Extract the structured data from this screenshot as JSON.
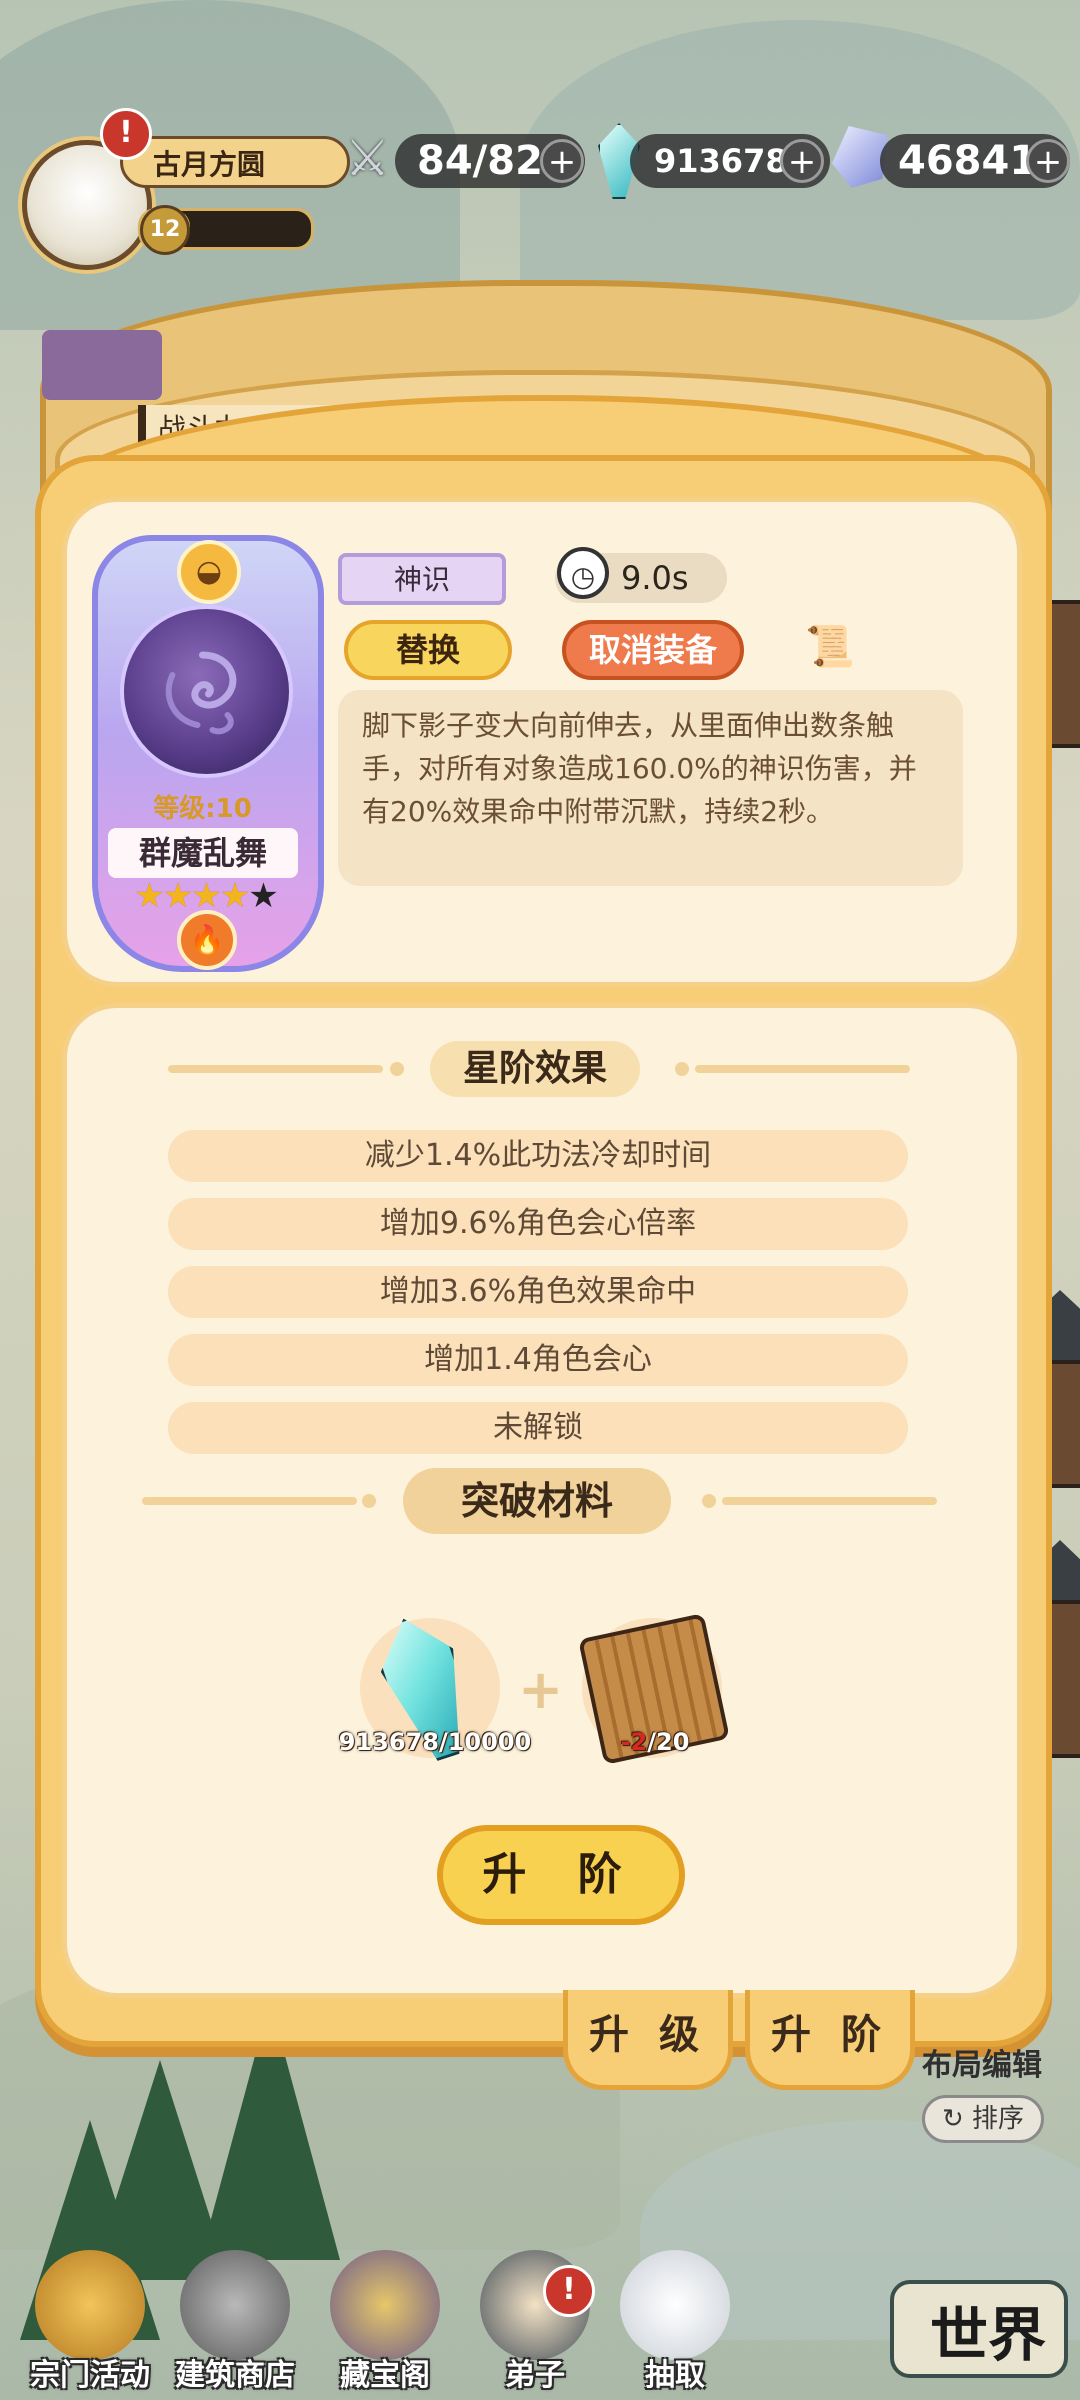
{
  "player": {
    "name": "古月方圆",
    "level": "12",
    "level_progress": 0.3,
    "alert": "!"
  },
  "resources": [
    {
      "icon": "sword-icon",
      "value": "84/82",
      "plus": "+"
    },
    {
      "icon": "crystal-icon",
      "value": "913678",
      "plus": "+"
    },
    {
      "icon": "gem-icon",
      "value": "46841",
      "plus": "+"
    }
  ],
  "background_panel": {
    "label": "战斗力"
  },
  "skill": {
    "level_text": "等级:10",
    "name": "群魔乱舞",
    "stars_filled": 4,
    "stars_total": 5,
    "star_glyph": "★",
    "type": "神识",
    "cooldown": "9.0s",
    "replace_label": "替换",
    "unequip_label": "取消装备",
    "description": "脚下影子变大向前伸去，从里面伸出数条触手，对所有对象造成160.0%的神识伤害，并有20%效果命中附带沉默，持续2秒。"
  },
  "star_effects": {
    "title": "星阶效果",
    "items": [
      "减少1.4%此功法冷却时间",
      "增加9.6%角色会心倍率",
      "增加3.6%角色效果命中",
      "增加1.4角色会心",
      "未解锁"
    ]
  },
  "materials": {
    "title": "突破材料",
    "items": [
      {
        "icon": "crystal-material-icon",
        "count": "913678/10000"
      },
      {
        "icon": "scroll-material-icon",
        "count_have": "-2",
        "count_need": "/20"
      }
    ],
    "plus": "+"
  },
  "upgrade_button": "升 阶",
  "tabs": [
    "升 级",
    "升 阶"
  ],
  "side": {
    "layout_edit": "布局编辑",
    "sort": "排序"
  },
  "nav": [
    {
      "label": "宗门活动",
      "icon": "pagoda-icon"
    },
    {
      "label": "建筑商店",
      "icon": "building-icon"
    },
    {
      "label": "藏宝阁",
      "icon": "treasure-icon"
    },
    {
      "label": "弟子",
      "icon": "disciple-icon",
      "alert": "!"
    },
    {
      "label": "抽取",
      "icon": "owl-icon"
    }
  ],
  "world_label": "世界",
  "colors": {
    "accent_gold": "#f7cd75",
    "panel_cream": "#fdf3dc",
    "unequip_orange": "#ef7a4b",
    "alert_red": "#c9362b"
  }
}
